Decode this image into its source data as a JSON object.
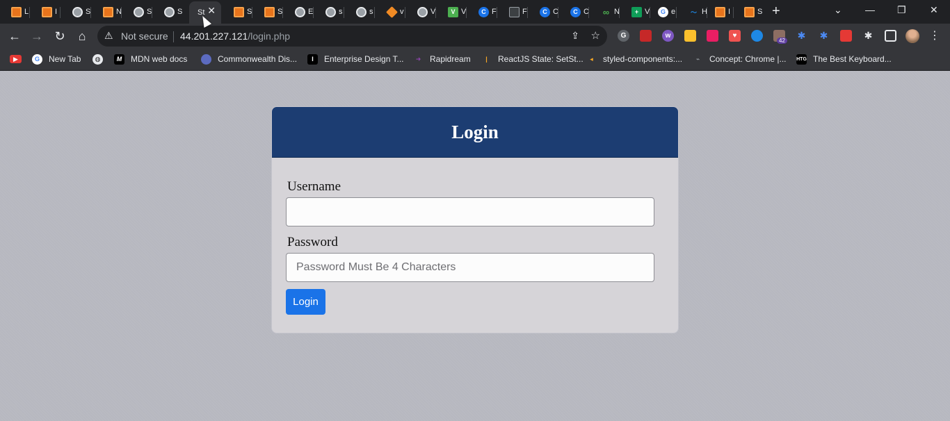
{
  "browser": {
    "tabs": [
      {
        "icon": "orange-square-icon",
        "title": "L"
      },
      {
        "icon": "orange-square-icon",
        "title": "I"
      },
      {
        "icon": "globe-icon",
        "title": "S"
      },
      {
        "icon": "orange-square-icon",
        "title": "N"
      },
      {
        "icon": "globe-icon",
        "title": "S"
      },
      {
        "icon": "globe-icon",
        "title": "S"
      },
      {
        "icon": "none",
        "title": "St",
        "active": true
      },
      {
        "icon": "orange-square-icon",
        "title": "S"
      },
      {
        "icon": "orange-square-icon",
        "title": "S"
      },
      {
        "icon": "globe-icon",
        "title": "E"
      },
      {
        "icon": "globe-icon",
        "title": "s"
      },
      {
        "icon": "globe-icon",
        "title": "s"
      },
      {
        "icon": "cube-icon",
        "title": "v"
      },
      {
        "icon": "globe-icon",
        "title": "V"
      },
      {
        "icon": "v-icon",
        "title": "V"
      },
      {
        "icon": "c-circle-icon",
        "title": "F"
      },
      {
        "icon": "dark-square-icon",
        "title": "F"
      },
      {
        "icon": "c-circle-icon",
        "title": "C"
      },
      {
        "icon": "c-circle-icon",
        "title": "C"
      },
      {
        "icon": "infinity-icon",
        "title": "N"
      },
      {
        "icon": "plus-icon",
        "title": "V"
      },
      {
        "icon": "google-icon",
        "title": "e"
      },
      {
        "icon": "wave-icon",
        "title": "H"
      },
      {
        "icon": "orange-square-icon",
        "title": "I"
      },
      {
        "icon": "orange-square-icon",
        "title": "S"
      }
    ],
    "new_tab_symbol": "+",
    "address": {
      "security": "Not secure",
      "host": "44.201.227.121",
      "path": "/login.php"
    },
    "extension_badge": "42",
    "bookmarks": [
      {
        "icon": "youtube-icon",
        "label": ""
      },
      {
        "icon": "google-icon",
        "label": "New Tab"
      },
      {
        "icon": "globe-icon",
        "label": ""
      },
      {
        "icon": "mdn-icon",
        "label": "MDN web docs"
      },
      {
        "icon": "globe-icon",
        "label": "Commonwealth Dis..."
      },
      {
        "icon": "ibm-icon",
        "label": "Enterprise Design T..."
      },
      {
        "icon": "rapidream-icon",
        "label": "Rapidream"
      },
      {
        "icon": "react-icon",
        "label": "ReactJS State: SetSt..."
      },
      {
        "icon": "styled-icon",
        "label": "styled-components:..."
      },
      {
        "icon": "chrome-concept-icon",
        "label": "Concept: Chrome |..."
      },
      {
        "icon": "htg-icon",
        "label": "The Best Keyboard..."
      }
    ]
  },
  "login_form": {
    "title": "Login",
    "username_label": "Username",
    "username_value": "",
    "password_label": "Password",
    "password_placeholder": "Password Must Be 4 Characters",
    "submit_label": "Login"
  },
  "colors": {
    "header_bg": "#1c3d72",
    "button_bg": "#1a73e8",
    "page_bg": "#b7b8c0"
  }
}
